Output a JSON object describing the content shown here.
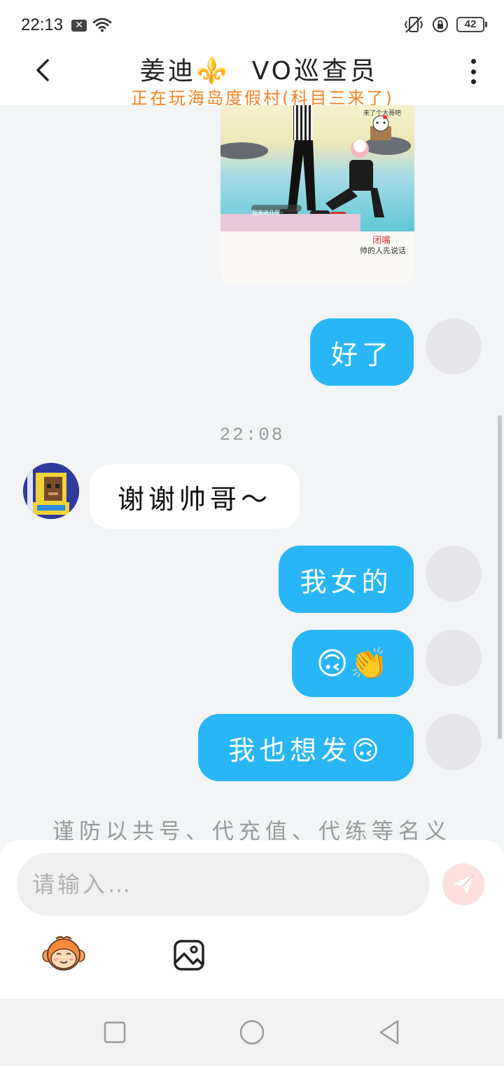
{
  "status_bar": {
    "time": "22:13",
    "notification_badge": "✕",
    "battery": "42"
  },
  "header": {
    "title_part1": "姜迪",
    "title_emoji": "⚜️",
    "title_part2": "VO巡查员",
    "subtitle": "正在玩海岛度假村(科目三来了)"
  },
  "chat": {
    "image_card": {
      "top_caption": "来了个大哥吧",
      "bottom_caption": "我来说几句~",
      "caption_red": "闭嘴",
      "caption_black": "帅的人先说话"
    },
    "messages": [
      {
        "side": "out",
        "text": "好了"
      },
      {
        "side": "timestamp",
        "text": "22:08"
      },
      {
        "side": "in",
        "text": "谢谢帅哥～"
      },
      {
        "side": "out",
        "text": "我女的"
      },
      {
        "side": "out",
        "text": "🙃👏"
      },
      {
        "side": "out",
        "text": "我也想发🙃"
      }
    ],
    "notice": "谨防以共号、代充值、代练等名义"
  },
  "input": {
    "placeholder": "请输入…",
    "value": ""
  },
  "icons": {
    "back": "chevron-left-icon",
    "more": "vertical-dots-icon",
    "send": "paper-plane-icon",
    "emoji": "monkey-face-icon",
    "image": "image-icon"
  },
  "colors": {
    "bubble_out": "#29b6f6",
    "bubble_in": "#ffffff",
    "subtitle": "#f5821f",
    "send_button": "#fde0dd",
    "background": "#f3f4f6"
  }
}
